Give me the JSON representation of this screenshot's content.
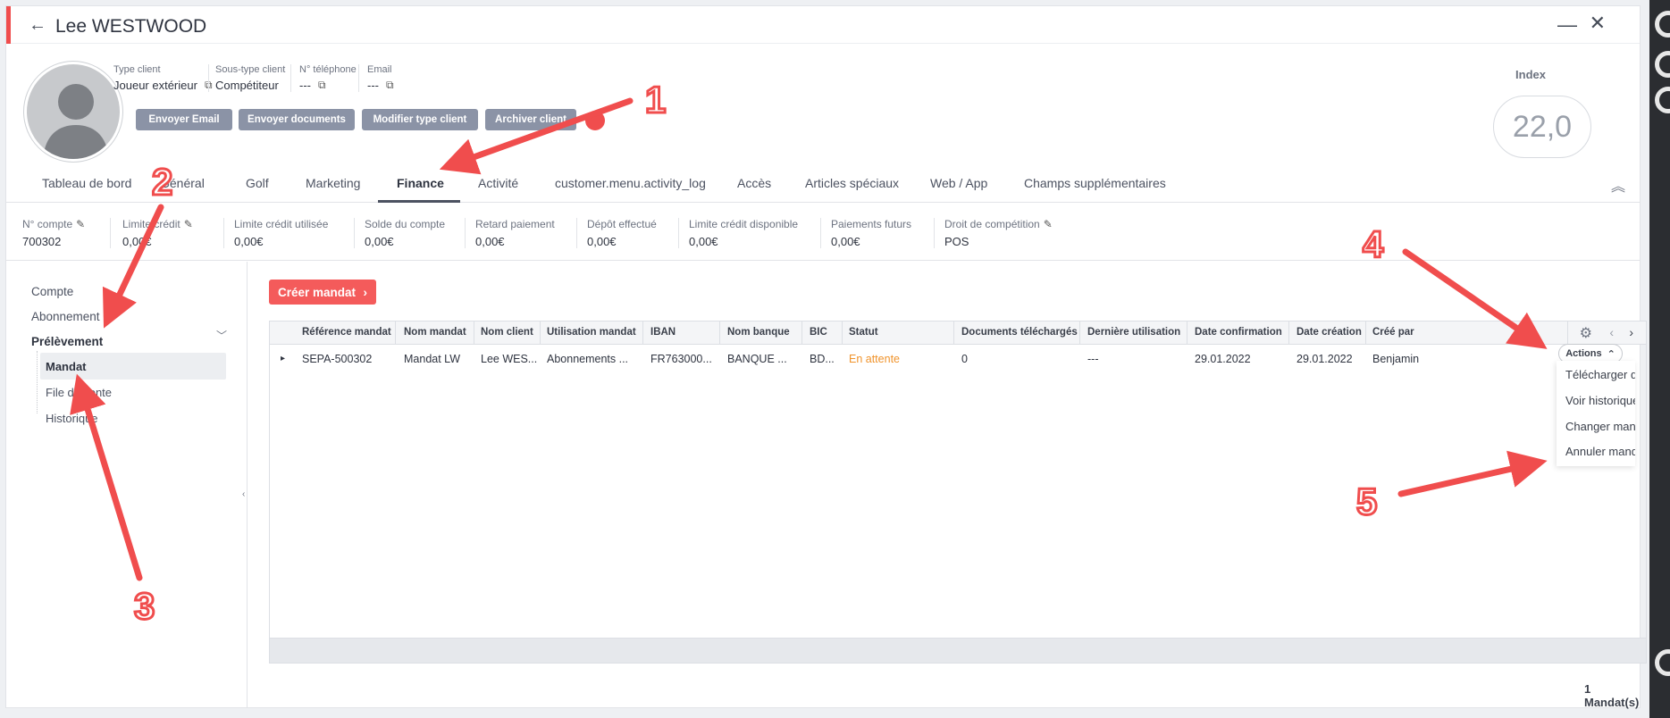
{
  "window": {
    "title": "Lee WESTWOOD",
    "back_icon": "arrow-left-icon",
    "minimize_icon": "minimize-icon",
    "close_icon": "close-icon"
  },
  "client": {
    "type_client_label": "Type client",
    "type_client_value": "Joueur extérieur",
    "sous_type_label": "Sous-type client",
    "sous_type_value": "Compétiteur",
    "phone_label": "N° téléphone",
    "phone_value": "---",
    "email_label": "Email",
    "email_value": "---"
  },
  "actions_top": [
    "Envoyer Email",
    "Envoyer documents",
    "Modifier type client",
    "Archiver client"
  ],
  "index": {
    "label": "Index",
    "value": "22,0"
  },
  "tabs": [
    "Tableau de bord",
    "Général",
    "Golf",
    "Marketing",
    "Finance",
    "Activité",
    "customer.menu.activity_log",
    "Accès",
    "Articles spéciaux",
    "Web / App",
    "Champs supplémentaires"
  ],
  "active_tab": "Finance",
  "stats": [
    {
      "label": "N° compte",
      "value": "700302"
    },
    {
      "label": "Limite crédit",
      "value": "0,00€"
    },
    {
      "label": "Limite crédit utilisée",
      "value": "0,00€"
    },
    {
      "label": "Solde du compte",
      "value": "0,00€"
    },
    {
      "label": "Retard paiement",
      "value": "0,00€"
    },
    {
      "label": "Dépôt effectué",
      "value": "0,00€"
    },
    {
      "label": "Limite crédit disponible",
      "value": "0,00€"
    },
    {
      "label": "Paiements futurs",
      "value": "0,00€"
    },
    {
      "label": "Droit de compétition",
      "value": "POS"
    }
  ],
  "sidebar": {
    "items": [
      "Compte",
      "Abonnement",
      "Prélèvement"
    ],
    "sub_items": [
      "Mandat",
      "File d'attente",
      "Historique"
    ]
  },
  "create_button": "Créer mandat",
  "grid": {
    "headers": [
      "Référence mandat",
      "Nom mandat",
      "Nom client",
      "Utilisation mandat",
      "IBAN",
      "Nom banque",
      "BIC",
      "Statut",
      "Documents téléchargés",
      "Dernière utilisation",
      "Date confirmation",
      "Date création",
      "Créé par"
    ],
    "row": [
      "SEPA-500302",
      "Mandat LW",
      "Lee WES...",
      "Abonnements ...",
      "FR763000...",
      "BANQUE ...",
      "BD...",
      "En attente",
      "0",
      "---",
      "29.01.2022",
      "29.01.2022",
      "Benjamin"
    ],
    "count": "1 Mandat(s)"
  },
  "actions_menu": {
    "button": "Actions",
    "items": [
      "Télécharger document",
      "Voir historique",
      "Changer mandat",
      "Annuler mandat"
    ]
  },
  "annotations": [
    "1",
    "2",
    "3",
    "4",
    "5"
  ],
  "colors": {
    "accent": "#f04d4d",
    "button_grey": "#8b93a6",
    "status_pending": "#f0932b"
  }
}
